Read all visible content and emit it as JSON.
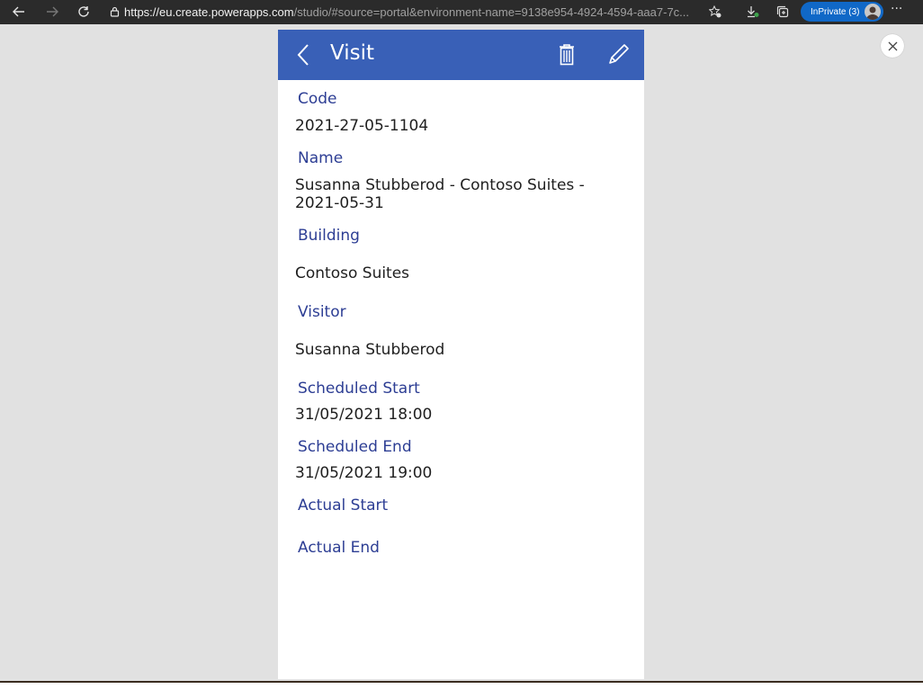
{
  "browser": {
    "url_host": "https://eu.create.powerapps.com",
    "url_rest": "/studio/#source=portal&environment-name=9138e954-4924-4594-aaa7-7c...",
    "inprivate_label": "InPrivate (3)",
    "more_label": "···"
  },
  "app": {
    "title": "Visit",
    "fields": [
      {
        "label": "Code",
        "value": "2021-27-05-1104"
      },
      {
        "label": "Name",
        "value": "Susanna Stubberod - Contoso Suites - 2021-05-31"
      },
      {
        "label": "Building",
        "value": "Contoso Suites"
      },
      {
        "label": "Visitor",
        "value": "Susanna Stubberod"
      },
      {
        "label": "Scheduled Start",
        "value": "31/05/2021 18:00"
      },
      {
        "label": "Scheduled End",
        "value": "31/05/2021 19:00"
      },
      {
        "label": "Actual Start",
        "value": ""
      },
      {
        "label": "Actual End",
        "value": ""
      }
    ]
  },
  "colors": {
    "header": "#3960b7",
    "label": "#2d3e94",
    "value": "#1f1f1f",
    "stage": "#e1e1e1"
  }
}
